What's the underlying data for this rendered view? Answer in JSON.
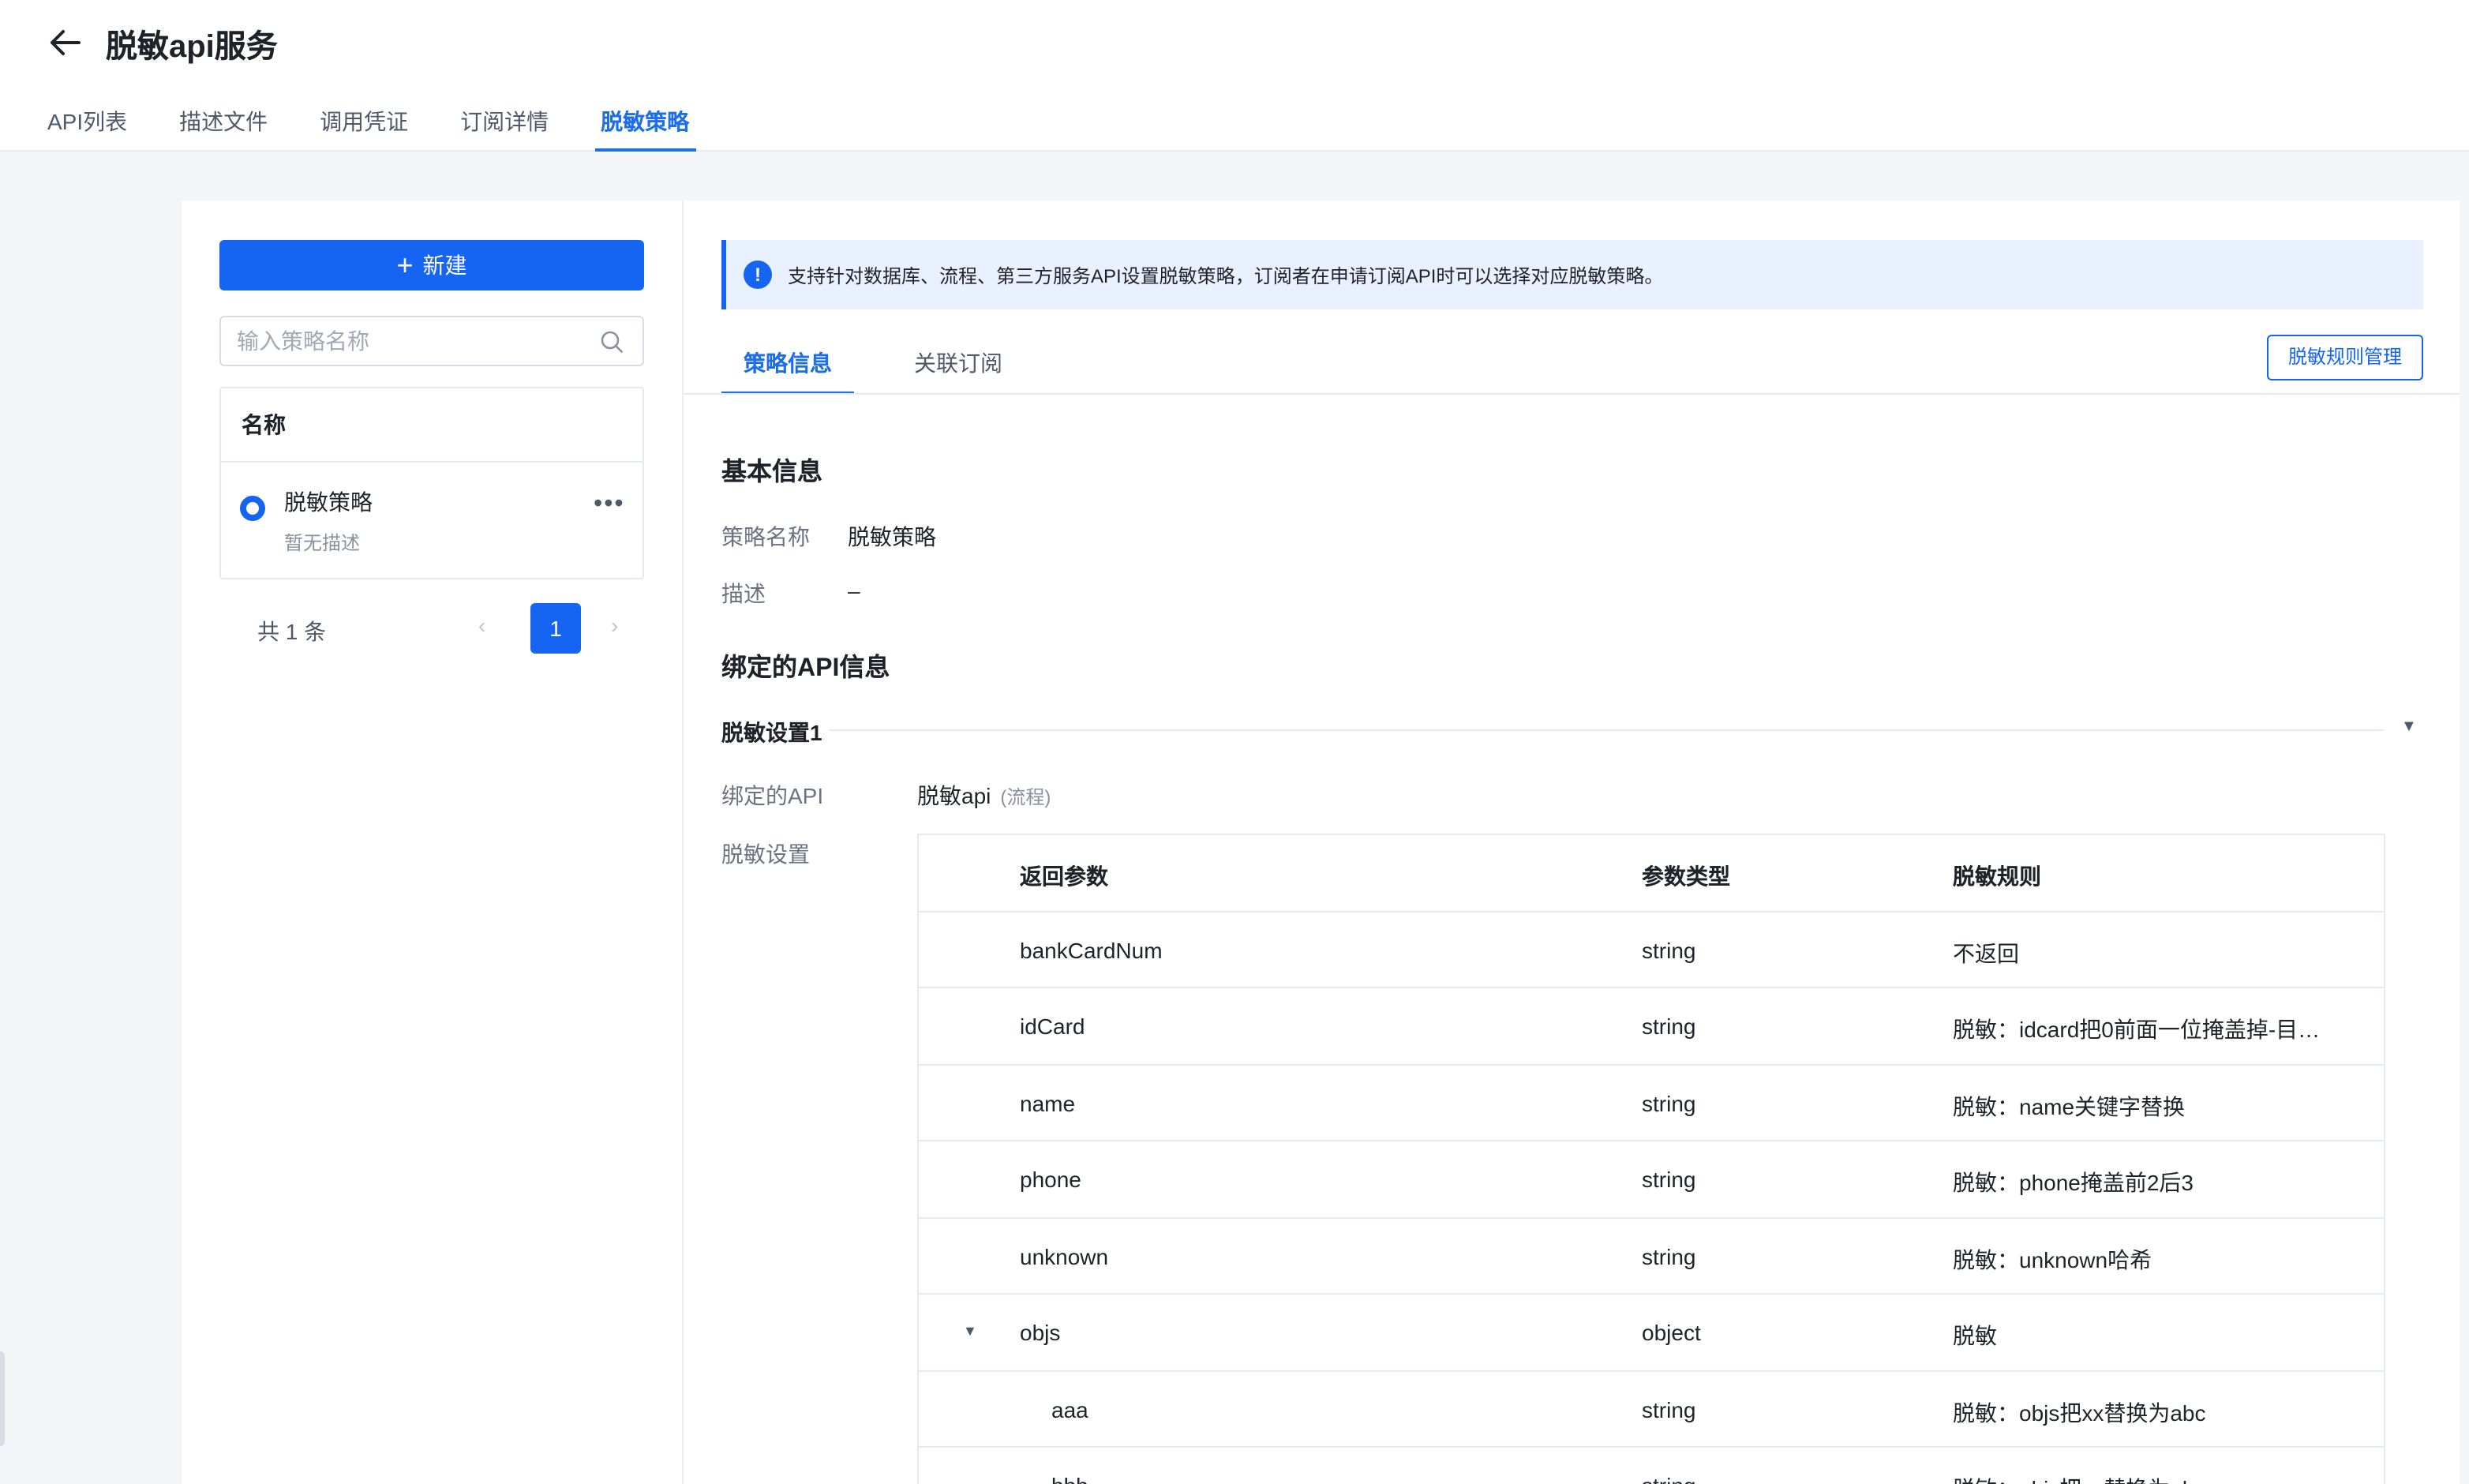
{
  "header": {
    "title": "脱敏api服务",
    "tabs": [
      {
        "label": "API列表"
      },
      {
        "label": "描述文件"
      },
      {
        "label": "调用凭证"
      },
      {
        "label": "订阅详情"
      },
      {
        "label": "脱敏策略"
      }
    ],
    "active_tab": "脱敏策略"
  },
  "left_panel": {
    "new_button_label": "新建",
    "search_placeholder": "输入策略名称",
    "list_header": "名称",
    "items": [
      {
        "name": "脱敏策略",
        "desc": "暂无描述",
        "selected": true
      }
    ],
    "pagination": {
      "total_text": "共 1 条",
      "current_page": "1",
      "prev": "‹",
      "next": "›"
    }
  },
  "right_panel": {
    "banner_icon": "!",
    "banner_text": "支持针对数据库、流程、第三方服务API设置脱敏策略，订阅者在申请订阅API时可以选择对应脱敏策略。",
    "sub_tabs": [
      {
        "label": "策略信息"
      },
      {
        "label": "关联订阅"
      }
    ],
    "rules_button_label": "脱敏规则管理",
    "basic_info": {
      "title": "基本信息",
      "name_label": "策略名称",
      "name_value": "脱敏策略",
      "desc_label": "描述",
      "desc_value": "–"
    },
    "bound_api": {
      "title": "绑定的API信息",
      "group_title": "脱敏设置1",
      "api_label": "绑定的API",
      "api_name": "脱敏api",
      "api_type": "(流程)",
      "setting_label": "脱敏设置",
      "table": {
        "headers": [
          "返回参数",
          "参数类型",
          "脱敏规则"
        ],
        "rows": [
          {
            "param": "bankCardNum",
            "type": "string",
            "rule": "不返回"
          },
          {
            "param": "idCard",
            "type": "string",
            "rule": "脱敏：idcard把0前面一位掩盖掉-目…"
          },
          {
            "param": "name",
            "type": "string",
            "rule": "脱敏：name关键字替换"
          },
          {
            "param": "phone",
            "type": "string",
            "rule": "脱敏：phone掩盖前2后3"
          },
          {
            "param": "unknown",
            "type": "string",
            "rule": "脱敏：unknown哈希"
          },
          {
            "param": "objs",
            "type": "object",
            "rule": "脱敏",
            "expandable": true
          },
          {
            "param": "aaa",
            "type": "string",
            "rule": "脱敏：objs把xx替换为abc",
            "child": true
          },
          {
            "param": "bbb",
            "type": "string",
            "rule": "脱敏：objs把xx替换为abc",
            "child": true
          }
        ]
      }
    }
  },
  "colors": {
    "primary": "#1565f2",
    "page_bg": "#f3f5f8",
    "banner_bg": "#e8f1fd"
  }
}
